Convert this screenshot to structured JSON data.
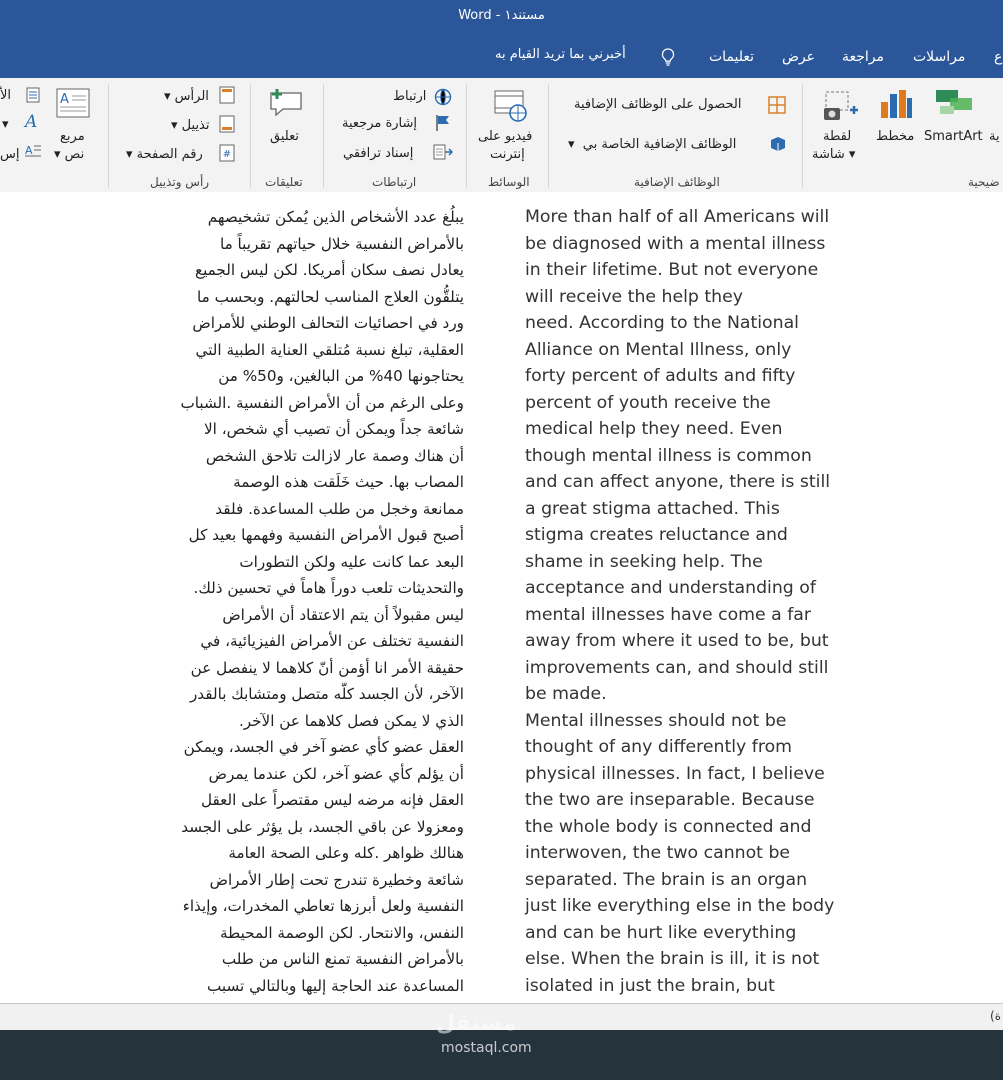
{
  "window": {
    "title": "Word  -  مستند١"
  },
  "tabs": {
    "mail": "مراسلات",
    "review": "مراجعة",
    "view": "عرض",
    "help": "تعليمات",
    "edge": "ع"
  },
  "tell_me": "أخبرني بما تريد القيام به",
  "ribbon": {
    "addins": {
      "get": "الحصول على الوظائف الإضافية",
      "my": "الوظائف الإضافية الخاصة بي",
      "label": "الوظائف الإضافية"
    },
    "media": {
      "online_video_1": "فيديو على",
      "online_video_2": "إنترنت",
      "label": "الوسائط"
    },
    "links": {
      "link": "ارتباط",
      "bookmark": "إشارة مرجعية",
      "cross_ref": "إسناد ترافقي",
      "label": "ارتباطات"
    },
    "comments": {
      "comment": "تعليق",
      "label": "تعليقات"
    },
    "header_footer": {
      "header": "الرأس",
      "footer": "تذييل",
      "page_number": "رقم الصفحة",
      "label": "رأس وتذييل"
    },
    "text": {
      "textbox_1": "مربع",
      "textbox_2": "نص",
      "edge1": "الأ",
      "edge2": "إس"
    },
    "illustrations": {
      "screenshot_1": "لقطة",
      "screenshot_2": "شاشة",
      "chart": "مخطط",
      "smartart": "SmartArt",
      "edge": "ية",
      "label_edge": "ضيحية"
    }
  },
  "document": {
    "arabic_lines": [
      "يبلُغ عدد الأشخاص الذين يُمكن تشخيصهم",
      "بالأمراض النفسية خلال حياتهم تقريباً ما",
      "يعادل نصف سكان أمريكا. لكن ليس الجميع",
      "يتلقُّون العلاج المناسب لحالتهم. وبحسب ما",
      "ورد في احصائيات التحالف الوطني للأمراض",
      "العقلية، تبلغ نسبة مُتلقي العناية الطبية التي",
      "يحتاجونها 40% من البالغين، و50% من",
      "وعلى الرغم من أن الأمراض النفسية .الشباب",
      "شائعة جداً ويمكن أن تصيب أي شخص، الا",
      "أن هناك وصمة عار لازالت تلاحق الشخص",
      "المصاب بها. حيث خَلَقت هذه الوصمة",
      "ممانعة وخجل من طلب المساعدة. فلقد",
      "أصبح قبول الأمراض النفسية وفهمها بعيد كل",
      "البعد عما كانت عليه ولكن التطورات",
      "والتحديثات تلعب دوراً هاماً في تحسين ذلك.",
      "ليس مقبولاً أن يتم الاعتقاد أن الأمراض",
      "النفسية تختلف عن الأمراض الفيزيائية، في",
      "حقيقة الأمر انا أؤمن أنّ كلاهما لا ينفصل عن",
      "الآخر، لأن الجسد كلّه متصل ومتشابك بالقدر",
      "الذي لا يمكن فصل كلاهما عن الآخر.",
      "العقل عضو كأي عضو آخر في الجسد، ويمكن",
      "أن يؤلم كأي عضو آخر، لكن عندما يمرض",
      "العقل فإنه مرضه ليس مقتصراً على العقل",
      "ومعزولا عن باقي الجسد، بل يؤثر على الجسد",
      "هنالك ظواهر .كله وعلى الصحة العامة",
      "شائعة وخطيرة تندرج تحت إطار الأمراض",
      "النفسية ولعل أبرزها تعاطي المخدرات، وإيذاء",
      "النفس، والانتحار. لكن الوصمة المحيطة",
      "بالأمراض النفسية تمنع الناس من طلب",
      "المساعدة عند الحاجة إليها وبالتالي تسبب"
    ],
    "english_lines": [
      "More than half of all Americans will",
      "be diagnosed with a mental illness",
      "in their lifetime. But not everyone",
      "will receive the help they",
      "need. According to the National",
      "Alliance on Mental Illness, only",
      "forty percent of adults and fifty",
      "percent of youth receive the",
      "medical help they need. Even",
      "though mental illness is common",
      "and can affect anyone, there is still",
      "a great stigma attached. This",
      "stigma creates reluctance and",
      "shame in seeking help.  The",
      "acceptance and understanding of",
      "mental illnesses have come a far",
      "away from where it used to be, but",
      "improvements can, and should still",
      "be made.",
      "Mental illnesses should not be",
      "thought of any differently from",
      "physical illnesses. In fact, I believe",
      "the two are inseparable. Because",
      "the whole body is connected and",
      "interwoven, the two cannot be",
      "separated. The brain is an organ",
      "just like everything else in the body",
      "and can be hurt like everything",
      "else. When the brain is ill, it is not",
      "isolated in just the brain, but"
    ]
  },
  "status": {
    "edge": "(ة"
  },
  "watermark": {
    "brand_ar": "مستقل",
    "brand_en": "mostaql.com"
  },
  "colors": {
    "word_blue": "#2b579a",
    "ribbon_bg": "#f3f3f3",
    "footer_bg": "#24333c"
  }
}
